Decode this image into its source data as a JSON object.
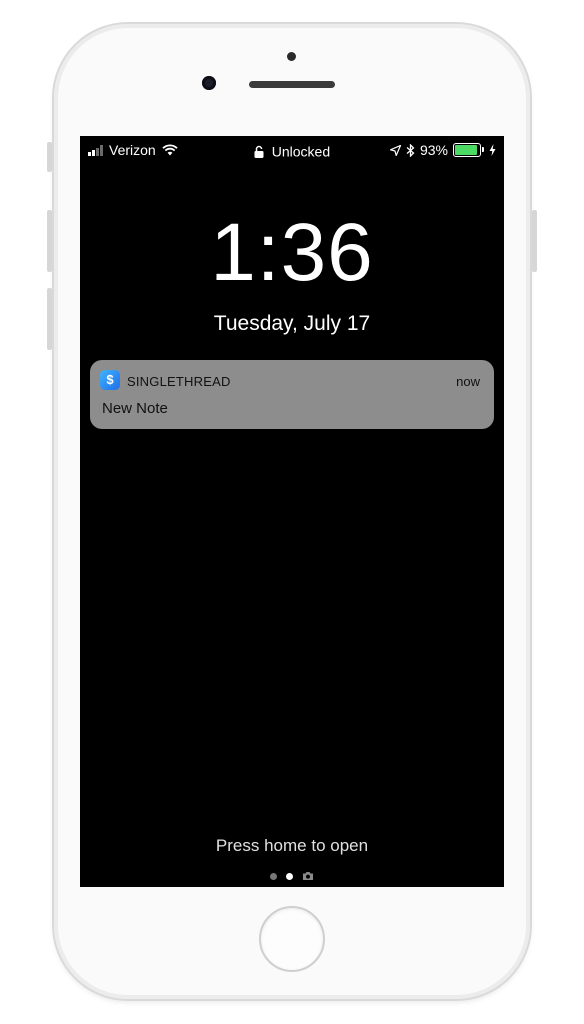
{
  "status_bar": {
    "carrier": "Verizon",
    "lock_status": "Unlocked",
    "battery_percent": "93%",
    "battery_level": 0.93,
    "battery_color": "#4cd964",
    "icons": [
      "signal-icon",
      "wifi-icon",
      "lock-icon",
      "location-icon",
      "bluetooth-icon",
      "battery-icon",
      "charging-icon"
    ]
  },
  "lock_screen": {
    "time": "1:36",
    "date": "Tuesday, July 17",
    "hint": "Press home to open"
  },
  "notification": {
    "app_name": "SINGLETHREAD",
    "app_icon_glyph": "$",
    "time": "now",
    "message": "New Note"
  },
  "page_indicator": {
    "pages": [
      "dot",
      "dot",
      "camera-icon"
    ],
    "active_index": 1
  }
}
